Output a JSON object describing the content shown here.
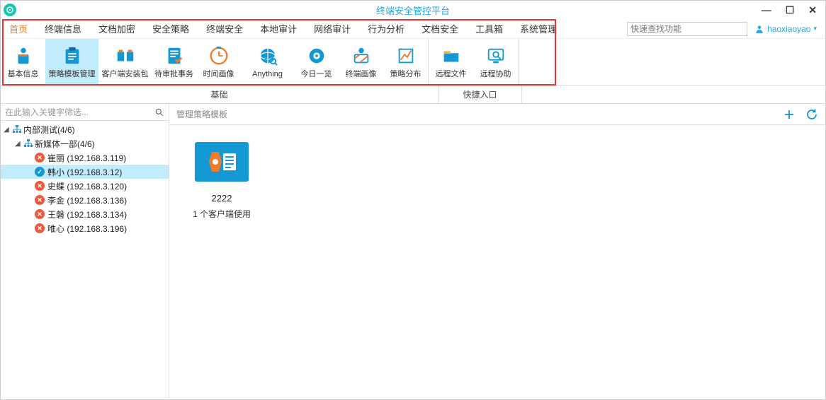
{
  "window": {
    "title": "终端安全管控平台"
  },
  "user": {
    "name": "haoxiaoyao"
  },
  "searchTop": {
    "placeholder": "快速查找功能"
  },
  "mainTabs": [
    "首页",
    "终端信息",
    "文档加密",
    "安全策略",
    "终端安全",
    "本地审计",
    "网络审计",
    "行为分析",
    "文档安全",
    "工具箱",
    "系统管理"
  ],
  "ribbon": {
    "group1": [
      {
        "key": "basic",
        "label": "基本信息"
      },
      {
        "key": "policy",
        "label": "策略模板管理",
        "active": true
      },
      {
        "key": "installer",
        "label": "客户端安装包"
      },
      {
        "key": "approval",
        "label": "待审批事务"
      },
      {
        "key": "timeimg",
        "label": "时间画像"
      },
      {
        "key": "anything",
        "label": "Anything"
      },
      {
        "key": "today",
        "label": "今日一览"
      },
      {
        "key": "termimg",
        "label": "终端画像"
      },
      {
        "key": "dist",
        "label": "策略分布"
      }
    ],
    "group2": [
      {
        "key": "remotefile",
        "label": "远程文件"
      },
      {
        "key": "remoteassist",
        "label": "远程协助"
      }
    ]
  },
  "sections": {
    "s1": "基础",
    "s2": "快捷入口"
  },
  "sidebar": {
    "placeholder": "在此输入关键字筛选...",
    "rootLabel": "内部测试(4/6)",
    "groupLabel": "新媒体一部(4/6)",
    "clients": [
      {
        "name": "崔丽",
        "ip": "192.168.3.119",
        "status": "err"
      },
      {
        "name": "韩小",
        "ip": "192.168.3.12",
        "status": "ok",
        "selected": true
      },
      {
        "name": "史蝶",
        "ip": "192.168.3.120",
        "status": "err"
      },
      {
        "name": "李金",
        "ip": "192.168.3.136",
        "status": "err"
      },
      {
        "name": "王磐",
        "ip": "192.168.3.134",
        "status": "err"
      },
      {
        "name": "唯心",
        "ip": "192.168.3.196",
        "status": "err"
      }
    ]
  },
  "content": {
    "header": "管理策略模板",
    "template": {
      "name": "2222",
      "sub": "1 个客户端使用"
    }
  }
}
